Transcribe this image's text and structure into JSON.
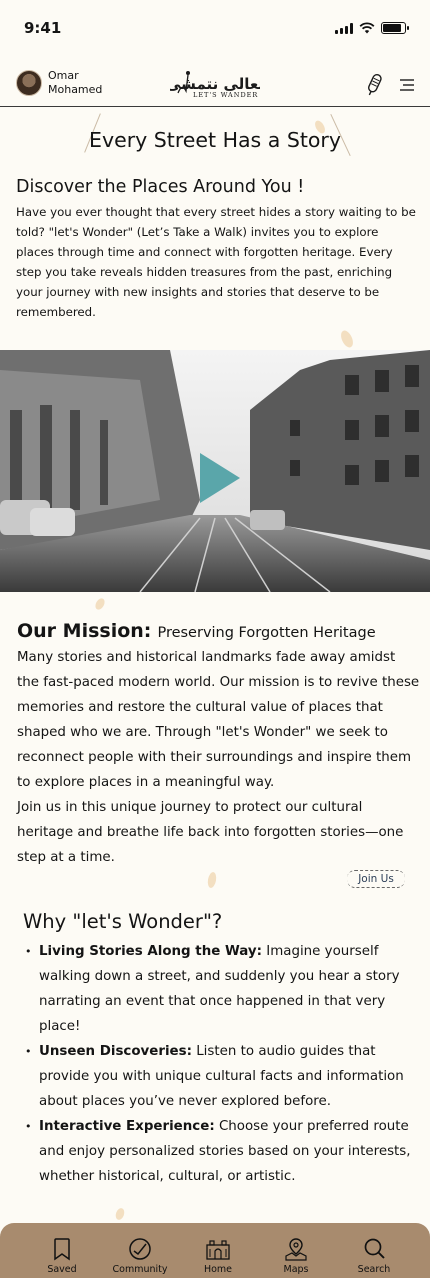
{
  "status": {
    "time": "9:41",
    "battery_level": 0.85
  },
  "header": {
    "user_name": "Omar Mohamed",
    "logo_arabic": "تعالى نتمشى",
    "logo_text": "LET'S WANDER"
  },
  "hero": {
    "title": "Every Street Has a Story"
  },
  "discover": {
    "title": "Discover the Places Around You !",
    "body": "Have you ever thought that every street hides a story waiting to be told? \"let's Wonder\" (Let’s Take a Walk) invites you to explore places through time and connect with forgotten heritage. Every step you take reveals hidden treasures from the past, enriching your journey with new insights and stories that deserve to be remembered."
  },
  "video": {
    "icon": "play-icon"
  },
  "mission": {
    "heading": "Our Mission:",
    "subheading": "Preserving Forgotten Heritage",
    "body1": "Many stories and historical landmarks fade away amidst the fast-paced modern world. Our mission is to revive these memories and restore the cultural value of places that shaped who we are. Through \"let's Wonder\" we seek to reconnect people with their surroundings and inspire them to explore places in a meaningful way.",
    "body2": "Join us in this unique journey to protect our cultural heritage and breathe life back into forgotten stories—one step at a time.",
    "join_label": "Join Us"
  },
  "why": {
    "title": "Why \"let's Wonder\"?",
    "items": [
      {
        "lead": "Living Stories Along the Way:",
        "text": " Imagine yourself walking down a street, and suddenly you hear a story narrating an event that once happened in that very place!"
      },
      {
        "lead": "Unseen Discoveries:",
        "text": " Listen to audio guides that provide you with unique cultural facts and information about places you’ve never explored before."
      },
      {
        "lead": "Interactive Experience:",
        "text": " Choose your preferred route and enjoy personalized stories based on your interests, whether historical, cultural, or artistic."
      }
    ]
  },
  "tabs": [
    {
      "label": "Saved",
      "icon": "bookmark-icon"
    },
    {
      "label": "Community",
      "icon": "community-icon"
    },
    {
      "label": "Home",
      "icon": "home-icon"
    },
    {
      "label": "Maps",
      "icon": "map-icon"
    },
    {
      "label": "Search",
      "icon": "search-icon"
    }
  ],
  "colors": {
    "background": "#fdfbf5",
    "tabbar": "#a88b6e",
    "accent": "#4a9ea3"
  }
}
